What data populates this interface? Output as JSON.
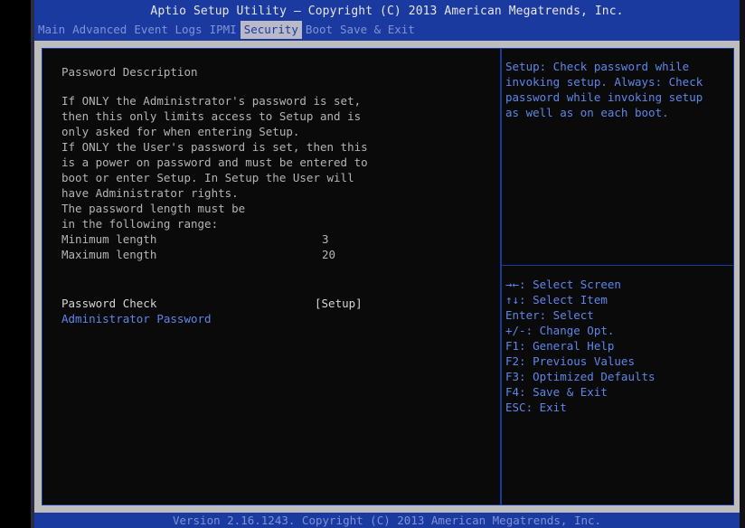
{
  "header": {
    "title": "Aptio Setup Utility – Copyright (C) 2013 American Megatrends, Inc.",
    "tabs": [
      {
        "label": "Main"
      },
      {
        "label": "Advanced"
      },
      {
        "label": "Event Logs"
      },
      {
        "label": "IPMI"
      },
      {
        "label": "Security",
        "active": true
      },
      {
        "label": "Boot"
      },
      {
        "label": "Save & Exit"
      }
    ]
  },
  "main": {
    "section_title": "Password Description",
    "description_lines": [
      "If ONLY the Administrator's password is set,",
      "then this only limits access to Setup and is",
      "only asked for when entering Setup.",
      "If ONLY the User's password is set, then this",
      "is a power on password and must be entered to",
      "boot or enter Setup. In Setup the User will",
      "have Administrator rights.",
      "The password length must be",
      "in the following range:"
    ],
    "min_length": {
      "label": "Minimum length",
      "value": "3"
    },
    "max_length": {
      "label": "Maximum length",
      "value": "20"
    },
    "password_check": {
      "label": "Password Check",
      "value": "[Setup]"
    },
    "admin_password": {
      "label": "Administrator Password"
    }
  },
  "help": {
    "description_lines": [
      "Setup: Check password while",
      "invoking setup. Always: Check",
      "password while invoking setup",
      "as well as on each boot."
    ],
    "keys": [
      "→←: Select Screen",
      "↑↓: Select Item",
      "Enter: Select",
      "+/-: Change Opt.",
      "F1: General Help",
      "F2: Previous Values",
      "F3: Optimized Defaults",
      "F4: Save & Exit",
      "ESC: Exit"
    ]
  },
  "footer": {
    "text": "Version 2.16.1243. Copyright (C) 2013 American Megatrends, Inc."
  },
  "colors": {
    "header_blue": "#1b3aa0",
    "text_gray": "#b4b4b4",
    "text_white": "#d6d6d6",
    "link_blue": "#5e86e8",
    "tab_inactive": "#7f93d6",
    "tab_active_bg": "#b9b9c8"
  }
}
